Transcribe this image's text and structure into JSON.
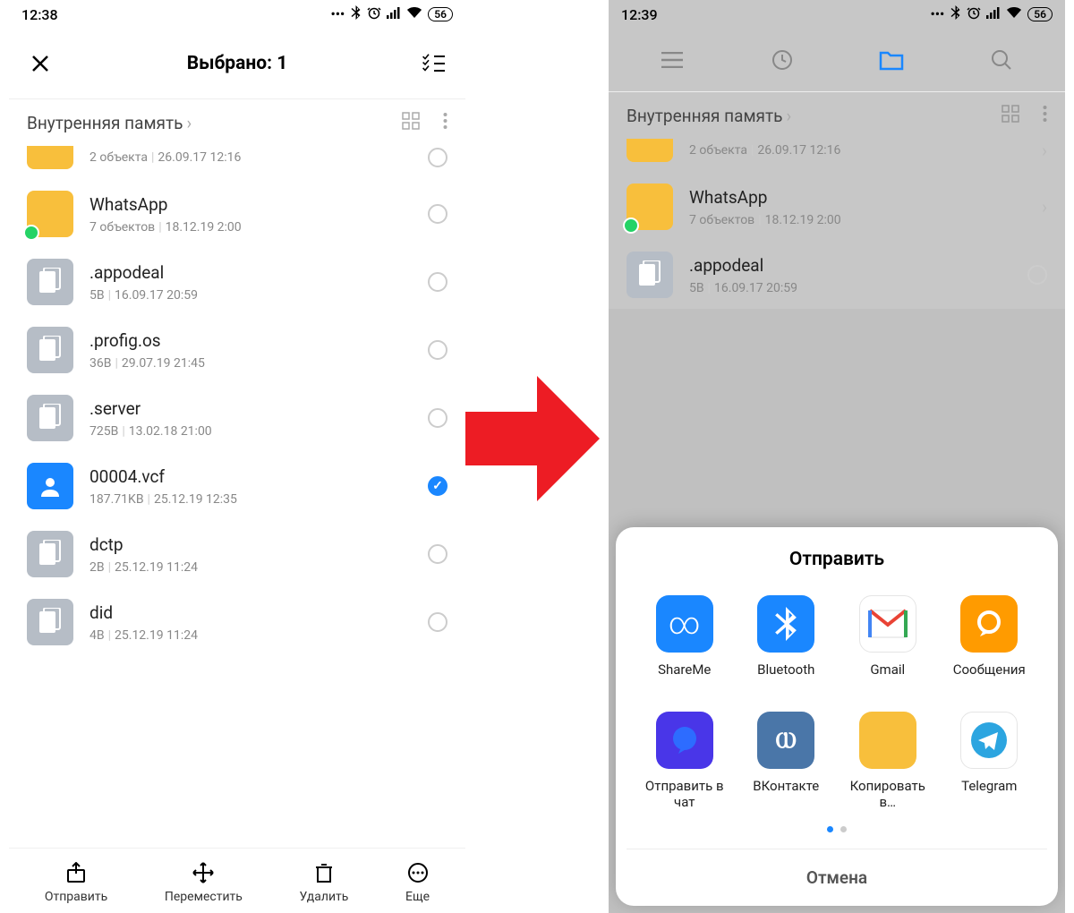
{
  "left": {
    "status": {
      "time": "12:38",
      "battery": "56"
    },
    "header_title": "Выбрано: 1",
    "breadcrumb": "Внутренняя память",
    "files": [
      {
        "name": "",
        "meta1": "2 объекта",
        "meta2": "26.09.17 12:16",
        "type": "folder",
        "selected": false,
        "partial": true
      },
      {
        "name": "WhatsApp",
        "meta1": "7 объектов",
        "meta2": "18.12.19 2:00",
        "type": "folder",
        "badge": "whatsapp",
        "selected": false
      },
      {
        "name": ".appodeal",
        "meta1": "5B",
        "meta2": "16.09.17 20:59",
        "type": "doc",
        "selected": false
      },
      {
        "name": ".profig.os",
        "meta1": "36B",
        "meta2": "29.07.19 21:45",
        "type": "doc",
        "selected": false
      },
      {
        "name": ".server",
        "meta1": "725B",
        "meta2": "13.02.18 21:00",
        "type": "doc",
        "selected": false
      },
      {
        "name": "00004.vcf",
        "meta1": "187.71KB",
        "meta2": "25.12.19 12:35",
        "type": "vcf",
        "selected": true
      },
      {
        "name": "dctp",
        "meta1": "2B",
        "meta2": "25.12.19 11:24",
        "type": "doc",
        "selected": false
      },
      {
        "name": "did",
        "meta1": "4B",
        "meta2": "25.12.19 11:24",
        "type": "doc",
        "selected": false,
        "partial": true
      }
    ],
    "actions": {
      "send": "Отправить",
      "move": "Переместить",
      "delete": "Удалить",
      "more": "Еще"
    }
  },
  "right": {
    "status": {
      "time": "12:39",
      "battery": "56"
    },
    "breadcrumb": "Внутренняя память",
    "files": [
      {
        "name": "",
        "meta1": "2 объекта",
        "meta2": "26.09.17 12:16",
        "type": "folder",
        "partial": true
      },
      {
        "name": "WhatsApp",
        "meta1": "7 объектов",
        "meta2": "18.12.19 2:00",
        "type": "folder",
        "badge": "whatsapp"
      },
      {
        "name": ".appodeal",
        "meta1": "5B",
        "meta2": "16.09.17 20:59",
        "type": "doc"
      }
    ],
    "share": {
      "title": "Отправить",
      "options": [
        {
          "label": "ShareMe",
          "color": "#1a87ff",
          "glyph": "∞"
        },
        {
          "label": "Bluetooth",
          "color": "#1a87ff",
          "glyph": "bt"
        },
        {
          "label": "Gmail",
          "color": "#ffffff",
          "glyph": "M"
        },
        {
          "label": "Сообщения",
          "color": "#ff9b00",
          "glyph": "○"
        },
        {
          "label": "Отправить в чат",
          "color": "#4936e8",
          "glyph": "Q"
        },
        {
          "label": "ВКонтакте",
          "color": "#4a76a8",
          "glyph": "VK"
        },
        {
          "label": "Копировать в…",
          "color": "#f8bf3c",
          "glyph": ""
        },
        {
          "label": "Telegram",
          "color": "#ffffff",
          "glyph": "tg"
        }
      ],
      "cancel": "Отмена"
    }
  }
}
